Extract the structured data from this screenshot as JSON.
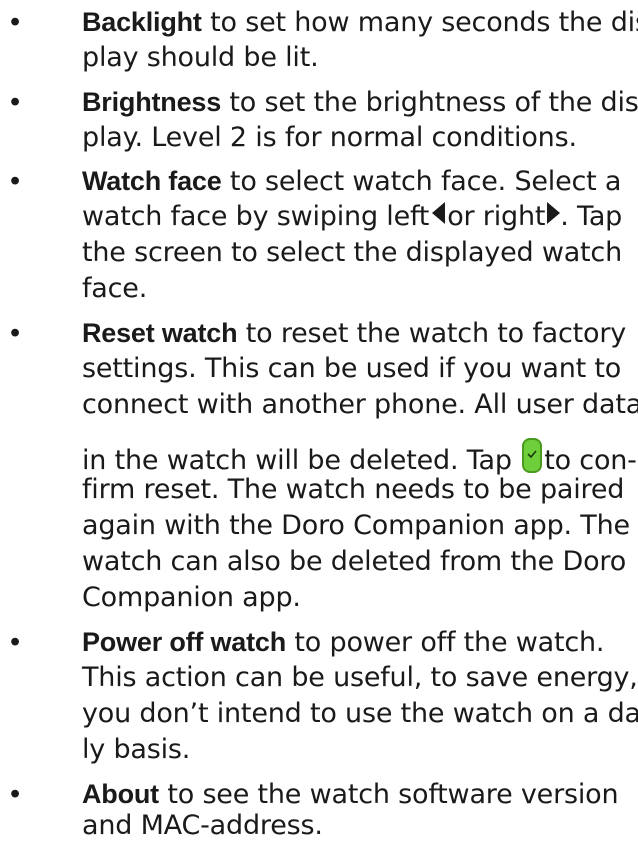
{
  "colors": {
    "text": "#1a1a1a",
    "confirm_green": "#6ecf3a"
  },
  "items": [
    {
      "term": "Backlight",
      "lines": [
        " to set how many seconds the dis-",
        "play should be lit."
      ]
    },
    {
      "term": "Brightness",
      "lines": [
        " to set the brightness of the dis-",
        "play. Level 2 is for normal conditions."
      ]
    },
    {
      "term": "Watch face",
      "lines": [
        " to select watch face. Select a",
        "watch face by swiping left",
        "or right",
        ". Tap",
        "the screen to select the displayed watch",
        "face."
      ]
    },
    {
      "term": "Reset watch",
      "lines": [
        " to reset the watch to factory",
        "settings. This can be used if you want to",
        "connect with another phone. All user data",
        "in the watch will be deleted. Tap",
        "to con-",
        "firm reset. The watch needs to be paired",
        "again with the Doro Companion app. The",
        "watch can also be deleted from the Doro",
        "Companion app."
      ]
    },
    {
      "term": "Power off watch",
      "lines": [
        " to power off the watch.",
        "This action can be useful, to save energy, if",
        "you don’t intend to use the watch on a dai-",
        "ly basis."
      ]
    },
    {
      "term": "About",
      "lines": [
        " to see the watch software version",
        "and MAC-address."
      ]
    }
  ],
  "bullet_char": "•",
  "icons": [
    "arrow-left-icon",
    "arrow-right-icon",
    "confirm-check-icon"
  ]
}
